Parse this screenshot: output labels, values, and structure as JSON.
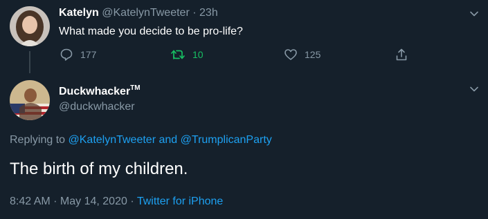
{
  "colors": {
    "background": "#15202b",
    "text": "#ffffff",
    "secondary": "#8899a6",
    "link": "#1da1f2",
    "retweet": "#17bf63"
  },
  "parent_tweet": {
    "name": "Katelyn",
    "handle": "@KatelynTweeter",
    "separator": "·",
    "time": "23h",
    "text": "What made you decide to be pro-life?",
    "actions": {
      "reply": {
        "icon": "comment-icon",
        "count": "177"
      },
      "retweet": {
        "icon": "retweet-icon",
        "count": "10"
      },
      "like": {
        "icon": "heart-icon",
        "count": "125"
      },
      "share": {
        "icon": "share-icon"
      }
    }
  },
  "reply_tweet": {
    "name": "Duckwhacker",
    "name_mark": "TM",
    "handle": "@duckwhacker",
    "replying_prefix": "Replying to",
    "replying_user1": "@KatelynTweeter",
    "replying_and": "and",
    "replying_user2": "@TrumplicanParty",
    "text": "The birth of my children.",
    "time": "8:42 AM · May 14, 2020",
    "separator": "·",
    "source": "Twitter for iPhone"
  }
}
